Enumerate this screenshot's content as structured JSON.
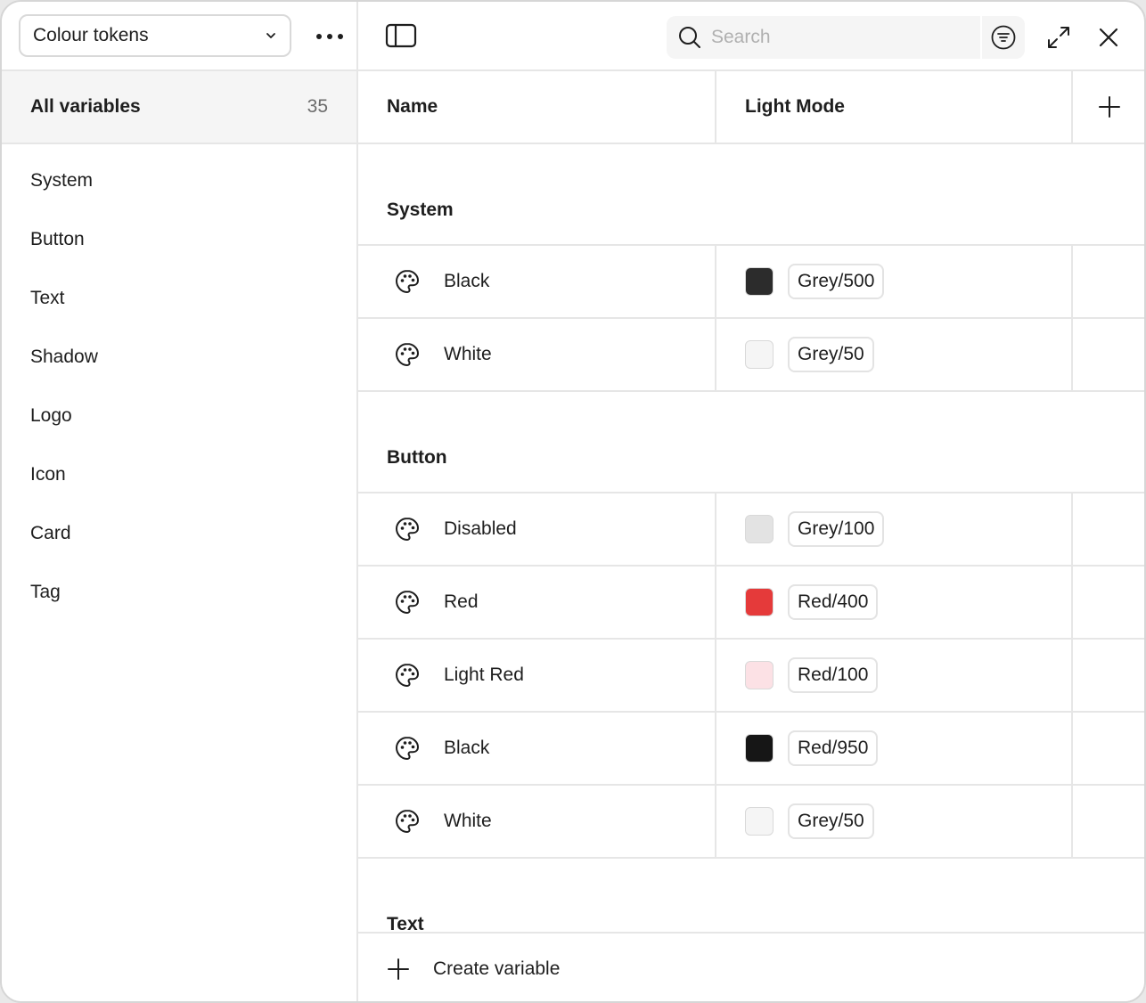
{
  "sidebar": {
    "collection": "Colour tokens",
    "all_variables": {
      "label": "All variables",
      "count": "35"
    },
    "groups": [
      "System",
      "Button",
      "Text",
      "Shadow",
      "Logo",
      "Icon",
      "Card",
      "Tag"
    ]
  },
  "toolbar": {
    "search_placeholder": "Search"
  },
  "table": {
    "columns": {
      "name": "Name",
      "mode": "Light Mode"
    },
    "sections": [
      {
        "title": "System",
        "rows": [
          {
            "name": "Black",
            "value": "Grey/500",
            "color": "#2c2c2c"
          },
          {
            "name": "White",
            "value": "Grey/50",
            "color": "#f5f5f5"
          }
        ]
      },
      {
        "title": "Button",
        "rows": [
          {
            "name": "Disabled",
            "value": "Grey/100",
            "color": "#e3e3e3"
          },
          {
            "name": "Red",
            "value": "Red/400",
            "color": "#e53a3a"
          },
          {
            "name": "Light Red",
            "value": "Red/100",
            "color": "#fce1e5"
          },
          {
            "name": "Black",
            "value": "Red/950",
            "color": "#161616"
          },
          {
            "name": "White",
            "value": "Grey/50",
            "color": "#f5f5f5"
          }
        ]
      },
      {
        "title": "Text",
        "rows": []
      }
    ]
  },
  "footer": {
    "create_label": "Create variable"
  },
  "icons": {
    "row_icon": "palette-icon",
    "toggle": "sidebar-toggle-icon",
    "search": "search-icon",
    "filter": "filter-icon",
    "expand": "expand-icon",
    "close": "close-icon",
    "add": "plus-icon",
    "more": "more-icon",
    "dropdown": "chevron-down-icon"
  }
}
